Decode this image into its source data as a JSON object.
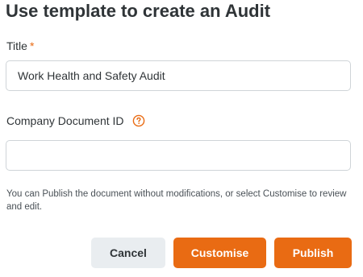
{
  "dialog": {
    "title": "Use template to create an Audit",
    "title_field": {
      "label": "Title",
      "required_mark": "*",
      "value": "Work Health and Safety Audit"
    },
    "doc_id_field": {
      "label": "Company Document ID",
      "help_icon": "question-circle-icon",
      "value": ""
    },
    "hint": "You can Publish the document without modifications, or select Customise to review and edit.",
    "buttons": {
      "cancel": "Cancel",
      "customise": "Customise",
      "publish": "Publish"
    }
  },
  "colors": {
    "accent": "#e96b13",
    "secondary_button": "#e9edf0",
    "text": "#2f3437",
    "border": "#cfd4d8"
  }
}
